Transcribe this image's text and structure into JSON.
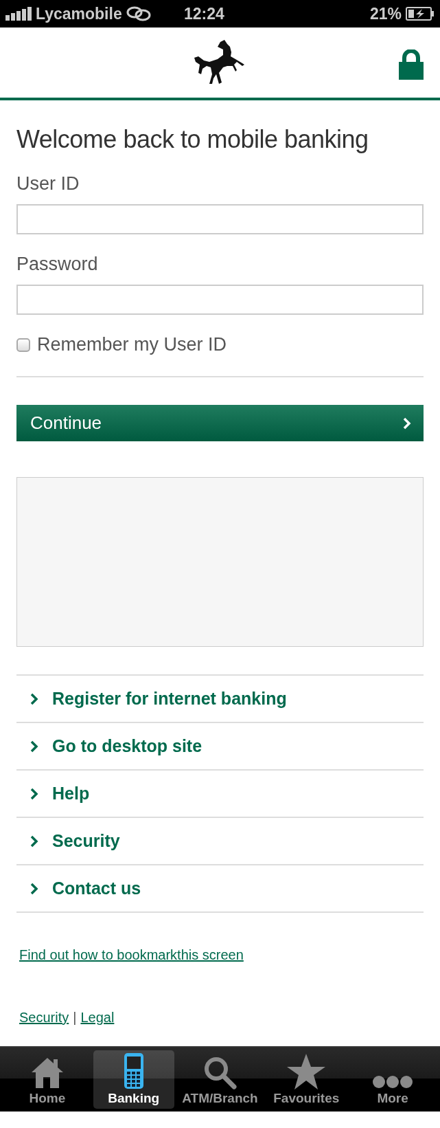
{
  "status_bar": {
    "carrier": "Lycamobile",
    "time": "12:24",
    "battery": "21%"
  },
  "title": "Welcome back to mobile banking",
  "fields": [
    {
      "label": "User ID"
    },
    {
      "label": "Password"
    }
  ],
  "remember": {
    "label": "Remember my User ID",
    "checked": false
  },
  "continue_button": {
    "label": "Continue"
  },
  "links": [
    "Register for internet banking",
    "Go to desktop site",
    "Help",
    "Security",
    "Contact us"
  ],
  "bookmark_link": "Find out how to bookmarkthis screen",
  "footer_links": {
    "items": [
      "Security",
      "Legal"
    ],
    "separator": "|"
  },
  "tabs": [
    {
      "label": "Home",
      "selected": false
    },
    {
      "label": "Banking",
      "selected": true
    },
    {
      "label": "ATM/Branch",
      "selected": false
    },
    {
      "label": "Favourites",
      "selected": false
    },
    {
      "label": "More",
      "selected": false
    }
  ]
}
